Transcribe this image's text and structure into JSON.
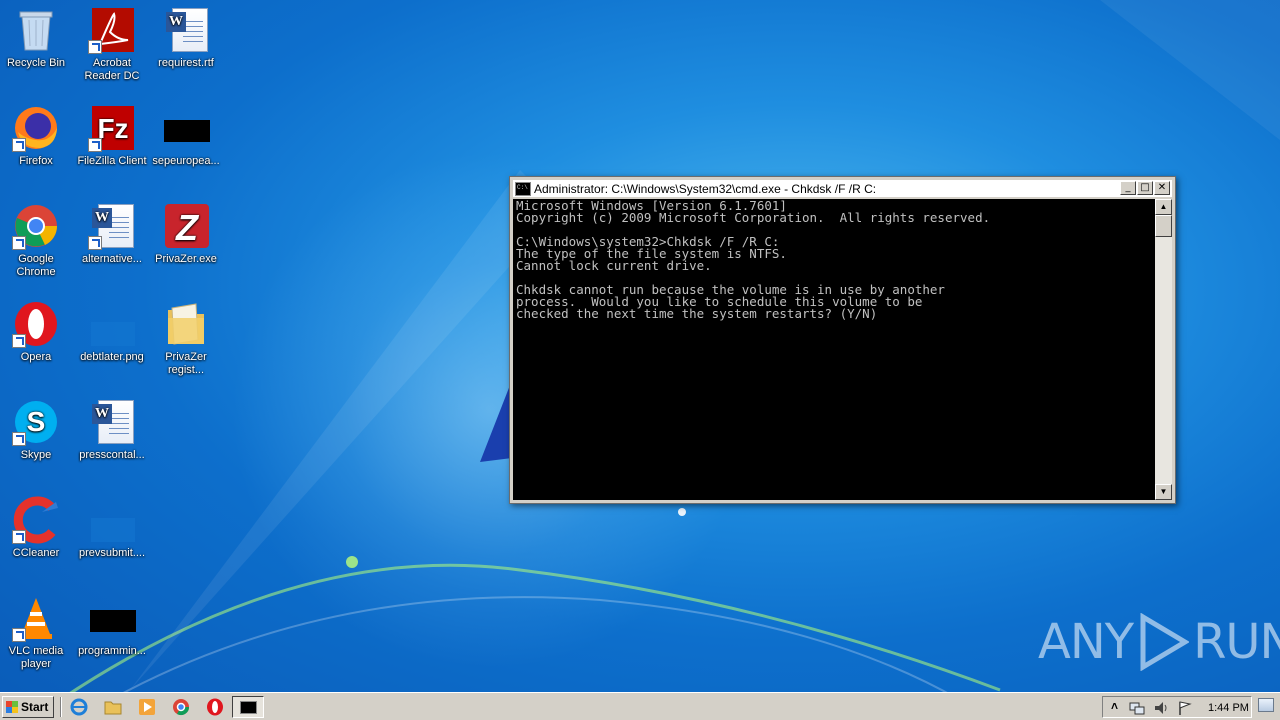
{
  "desktop": {
    "icons": [
      {
        "label": "Recycle Bin"
      },
      {
        "label": "Acrobat Reader DC"
      },
      {
        "label": "requirest.rtf"
      },
      {
        "label": "Firefox"
      },
      {
        "label": "FileZilla Client"
      },
      {
        "label": "sepeuropea..."
      },
      {
        "label": "Google Chrome"
      },
      {
        "label": "alternative..."
      },
      {
        "label": "PrivaZer.exe"
      },
      {
        "label": "Opera"
      },
      {
        "label": "debtlater.png"
      },
      {
        "label": "PrivaZer regist..."
      },
      {
        "label": "Skype"
      },
      {
        "label": "presscontal..."
      },
      {
        "label": "CCleaner"
      },
      {
        "label": "prevsubmit...."
      },
      {
        "label": "VLC media player"
      },
      {
        "label": "programmin..."
      }
    ]
  },
  "cmd_window": {
    "title": "Administrator: C:\\Windows\\System32\\cmd.exe - Chkdsk  /F /R C:",
    "minimize": "_",
    "maximize": "□",
    "close": "✕",
    "lines": [
      "Microsoft Windows [Version 6.1.7601]",
      "Copyright (c) 2009 Microsoft Corporation.  All rights reserved.",
      "",
      "C:\\Windows\\system32>Chkdsk /F /R C:",
      "The type of the file system is NTFS.",
      "Cannot lock current drive.",
      "",
      "Chkdsk cannot run because the volume is in use by another",
      "process.  Would you like to schedule this volume to be",
      "checked the next time the system restarts? (Y/N)"
    ]
  },
  "watermark": {
    "left": "ANY",
    "right": "RUN"
  },
  "taskbar": {
    "start_label": "Start",
    "clock": "1:44 PM",
    "tray_up": "˄"
  },
  "colors": {
    "console_bg": "#000000",
    "console_fg": "#c0c0c0",
    "desktop_blue": "#0d6fcc"
  }
}
